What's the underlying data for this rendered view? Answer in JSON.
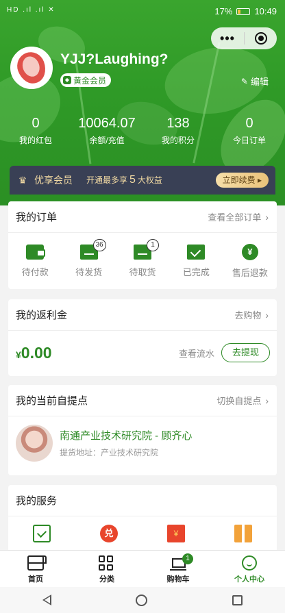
{
  "status_bar": {
    "signal": "HD .ıl .ıl ✕",
    "battery_text": "17%",
    "time": "10:49"
  },
  "capsule": {
    "more_label": "•••"
  },
  "profile": {
    "username": "YJJ?Laughing?",
    "badge": "黄金会员",
    "edit_label": "编辑"
  },
  "stats": [
    {
      "value": "0",
      "label": "我的红包"
    },
    {
      "value": "10064.07",
      "label": "余额/充值"
    },
    {
      "value": "138",
      "label": "我的积分"
    },
    {
      "value": "0",
      "label": "今日订单"
    }
  ],
  "vip": {
    "title": "优享会员",
    "desc_prefix": "开通最多享",
    "desc_number": "5",
    "desc_suffix": "大权益",
    "renew_label": "立即续费 ▸"
  },
  "orders": {
    "title": "我的订单",
    "link": "查看全部订单",
    "items": [
      {
        "label": "待付款",
        "icon": "wallet-icon",
        "count": ""
      },
      {
        "label": "待发货",
        "icon": "box-icon",
        "count": "36"
      },
      {
        "label": "待取货",
        "icon": "package-icon",
        "count": "1"
      },
      {
        "label": "已完成",
        "icon": "check-icon",
        "count": ""
      },
      {
        "label": "售后退款",
        "icon": "refund-icon",
        "count": ""
      }
    ]
  },
  "rebate": {
    "title": "我的返利金",
    "link": "去购物",
    "currency": "¥",
    "amount": "0.00",
    "flow_label": "查看流水",
    "withdraw_label": "去提现"
  },
  "pickup": {
    "title": "我的当前自提点",
    "link": "切换自提点",
    "name": "南通产业技术研究院 - 顾齐心",
    "address": "提货地址：产业技术研究院"
  },
  "services": {
    "title": "我的服务",
    "icons": [
      "calendar-check-icon",
      "coupon-icon",
      "red-envelope-icon",
      "gift-icon"
    ],
    "coupon_glyph": "兑",
    "red_glyph": "¥"
  },
  "tabbar": [
    {
      "label": "首页",
      "icon": "store-icon",
      "active": false
    },
    {
      "label": "分类",
      "icon": "category-icon",
      "active": false
    },
    {
      "label": "购物车",
      "icon": "cart-icon",
      "badge": "1",
      "active": false
    },
    {
      "label": "个人中心",
      "icon": "smile-icon",
      "active": true
    }
  ],
  "colors": {
    "brand_green": "#2e8a26",
    "header_green": "#3aa52e",
    "vip_bg": "#394055",
    "vip_gold": "#f1d9a3"
  }
}
